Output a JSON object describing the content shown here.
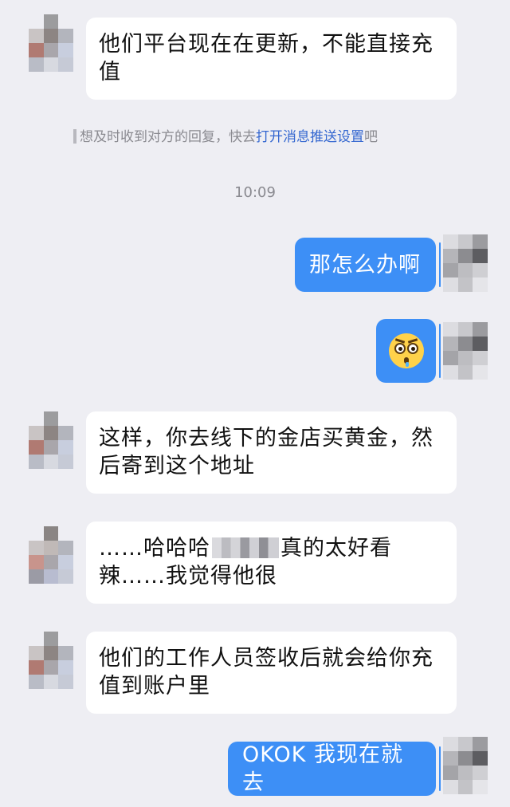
{
  "messages": [
    {
      "side": "left",
      "text": "他们平台现在在更新，不能直接充值"
    },
    {
      "side": "right",
      "text": "那怎么办啊"
    },
    {
      "side": "right",
      "emoji": "shocked-face-icon"
    },
    {
      "side": "left",
      "text": "这样，你去线下的金店买黄金，然后寄到这个地址"
    },
    {
      "side": "left",
      "text_before": "……哈哈哈",
      "text_after": "真的太好看辣……我觉得他很"
    },
    {
      "side": "left",
      "text": "他们的工作人员签收后就会给你充值到账户里"
    },
    {
      "side": "right",
      "text": "OKOK 我现在就去"
    }
  ],
  "notice": {
    "prefix": "想及时收到对方的回复，快去",
    "link": "打开消息推送设置",
    "suffix": "吧"
  },
  "timestamp": "10:09",
  "colors": {
    "background": "#eeeef3",
    "own_bubble": "#3d8ff6",
    "other_bubble": "#ffffff",
    "link": "#3467d0"
  }
}
